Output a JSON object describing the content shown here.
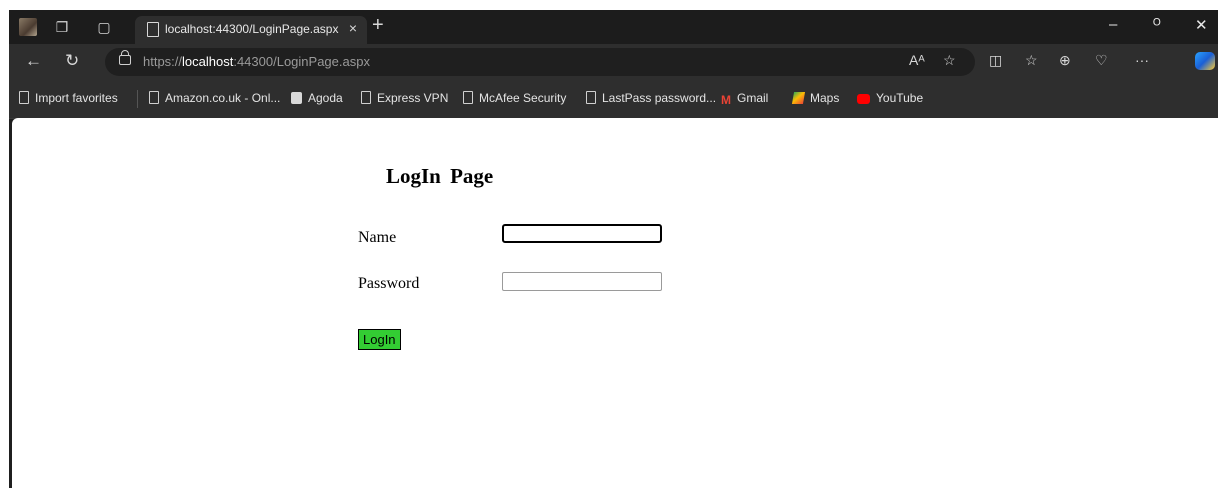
{
  "browser": {
    "tab_title": "localhost:44300/LoginPage.aspx",
    "tab_close": "×",
    "new_tab": "+",
    "window_controls": {
      "minimize": "–",
      "restore": "ᴼ",
      "close": "✕"
    },
    "address": {
      "prefix": "https://",
      "host": "localhost",
      "rest": ":44300/LoginPage.aspx"
    },
    "toolbar_icons": [
      "read-aloud-icon",
      "favorite-star-icon",
      "split-screen-icon",
      "favorites-icon",
      "collections-icon",
      "browser-essentials-icon",
      "more-icon",
      "copilot-icon"
    ],
    "favorites": [
      {
        "label": "Import favorites",
        "icon": "import-icon"
      },
      {
        "label": "Amazon.co.uk - Onl...",
        "icon": "page-icon"
      },
      {
        "label": "Agoda",
        "icon": "agoda-icon"
      },
      {
        "label": "Express VPN",
        "icon": "page-icon"
      },
      {
        "label": "McAfee Security",
        "icon": "page-icon"
      },
      {
        "label": "LastPass password...",
        "icon": "page-icon"
      },
      {
        "label": "Gmail",
        "icon": "gmail-icon"
      },
      {
        "label": "Maps",
        "icon": "maps-icon"
      },
      {
        "label": "YouTube",
        "icon": "youtube-icon"
      }
    ]
  },
  "page": {
    "title": "LogIn Page",
    "name_label": "Name",
    "name_value": "",
    "password_label": "Password",
    "password_value": "",
    "login_button": "LogIn",
    "colors": {
      "button_bg": "#33cc33"
    }
  }
}
